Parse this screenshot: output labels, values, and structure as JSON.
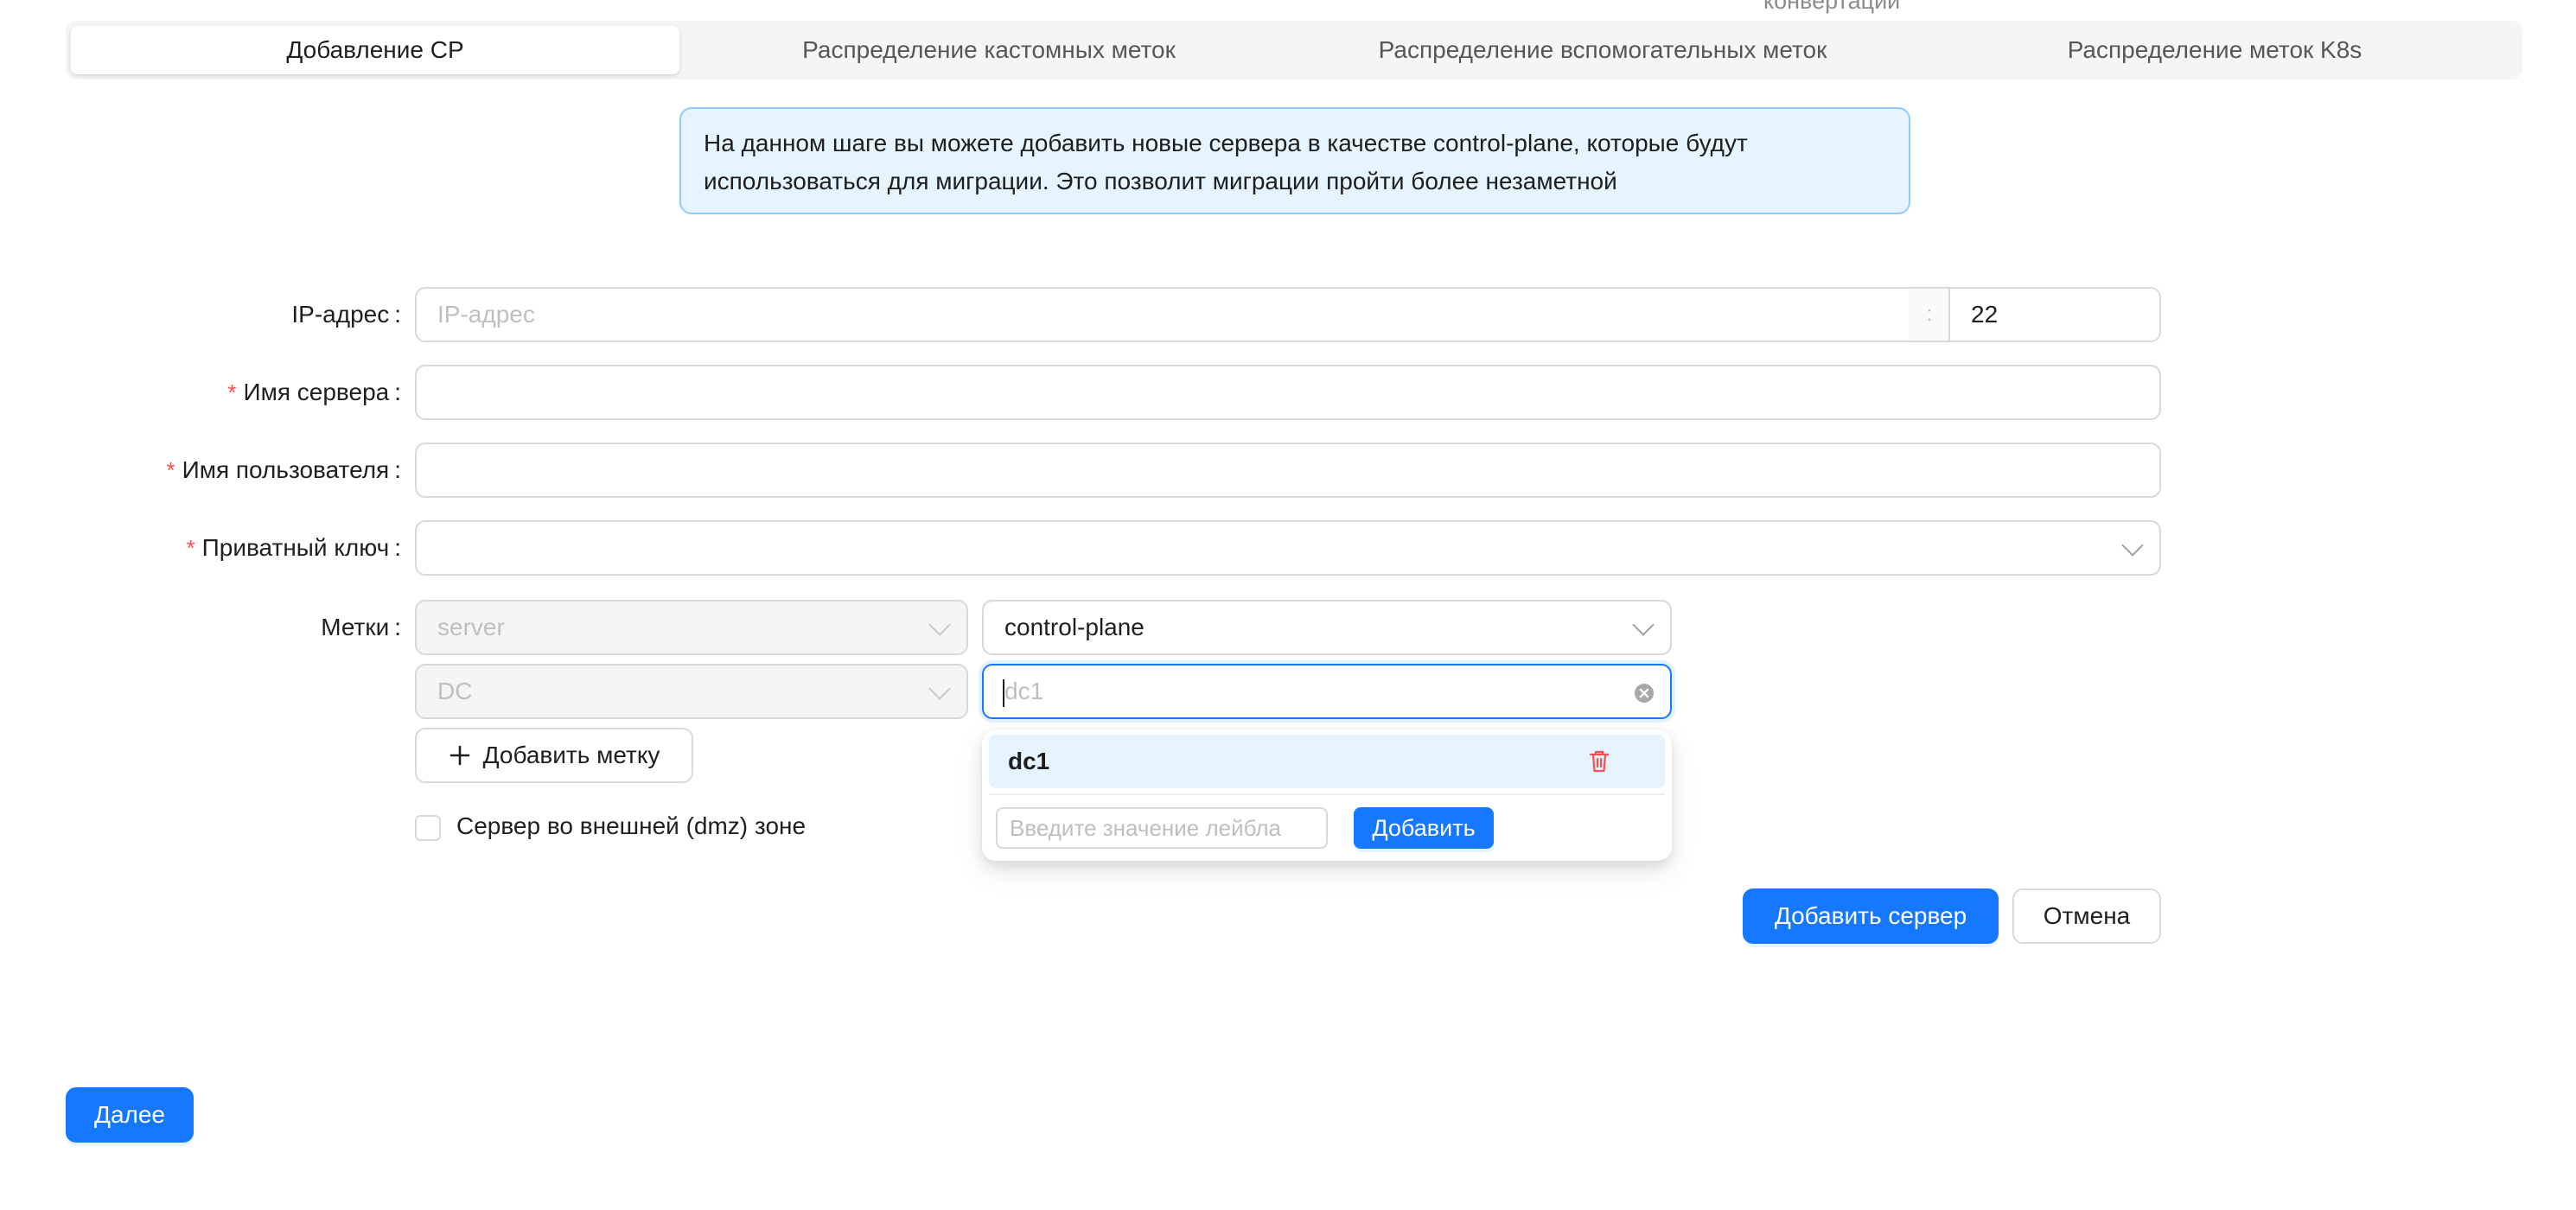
{
  "step_caption": "конвертации",
  "tabs": [
    {
      "label": "Добавление CP",
      "active": true
    },
    {
      "label": "Распределение кастомных меток",
      "active": false
    },
    {
      "label": "Распределение вспомогательных меток",
      "active": false
    },
    {
      "label": "Распределение меток K8s",
      "active": false
    }
  ],
  "alert": {
    "text": "На данном шаге вы можете добавить новые сервера в качестве control-plane, которые будут использоваться для миграции. Это позволит миграции пройти более незаметной"
  },
  "form": {
    "ip": {
      "label": "IP-адрес",
      "placeholder": "IP-адрес",
      "separator": ":",
      "port": "22"
    },
    "server_name": {
      "label": "Имя сервера",
      "value": ""
    },
    "username": {
      "label": "Имя пользователя",
      "value": ""
    },
    "private_key": {
      "label": "Приватный ключ",
      "value": ""
    },
    "labels": {
      "label": "Метки",
      "rows": [
        {
          "key": "server",
          "value": "control-plane"
        },
        {
          "key": "DC",
          "value_placeholder": "dc1"
        }
      ],
      "add_label_button": "Добавить метку"
    },
    "dmz_checkbox": {
      "label": "Сервер во внешней (dmz) зоне",
      "checked": false
    }
  },
  "dropdown": {
    "options": [
      "dc1"
    ],
    "new_value_placeholder": "Введите значение лейбла",
    "add_button": "Добавить"
  },
  "actions": {
    "add_server": "Добавить сервер",
    "cancel": "Отмена",
    "next": "Далее"
  },
  "colors": {
    "primary": "#1677ff",
    "required": "#ff4d4f",
    "alert_bg": "#e6f4ff",
    "alert_border": "#91caff",
    "delete": "#ff4d4f"
  },
  "icons": [
    "plus-icon",
    "chevron-down-icon",
    "clear-icon",
    "delete-icon"
  ]
}
